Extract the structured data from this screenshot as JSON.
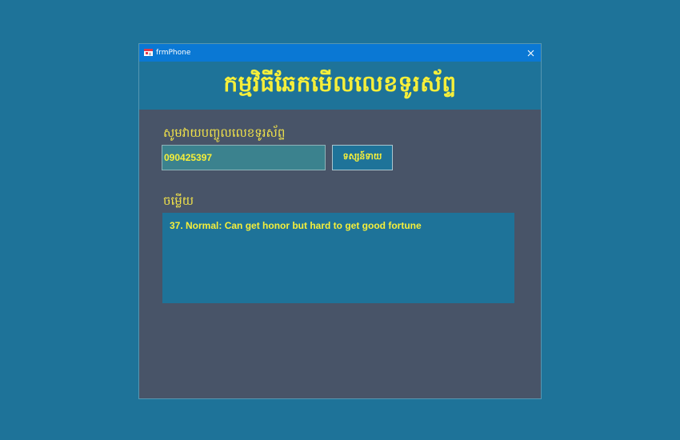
{
  "window": {
    "title": "frmPhone",
    "icon": "form-app-icon",
    "close_icon": "close-icon"
  },
  "header": {
    "title": "កម្មវិធីឆែកមើលលេខទូរស័ព្ទ"
  },
  "form": {
    "prompt_label": "សូមវាយបញ្ចូលលេខទូរស័ព្ទ",
    "phone_value": "090425397",
    "check_button_label": "ទស្សន៍ទាយ",
    "answer_label": "ចម្លើយ",
    "result_text": "37. Normal: Can get honor but hard to get good fortune"
  },
  "colors": {
    "desktop_background": "#1e7399",
    "window_background": "#485468",
    "titlebar": "#0a78d4",
    "accent_text": "#f6ef3a",
    "panel": "#1e7399"
  }
}
